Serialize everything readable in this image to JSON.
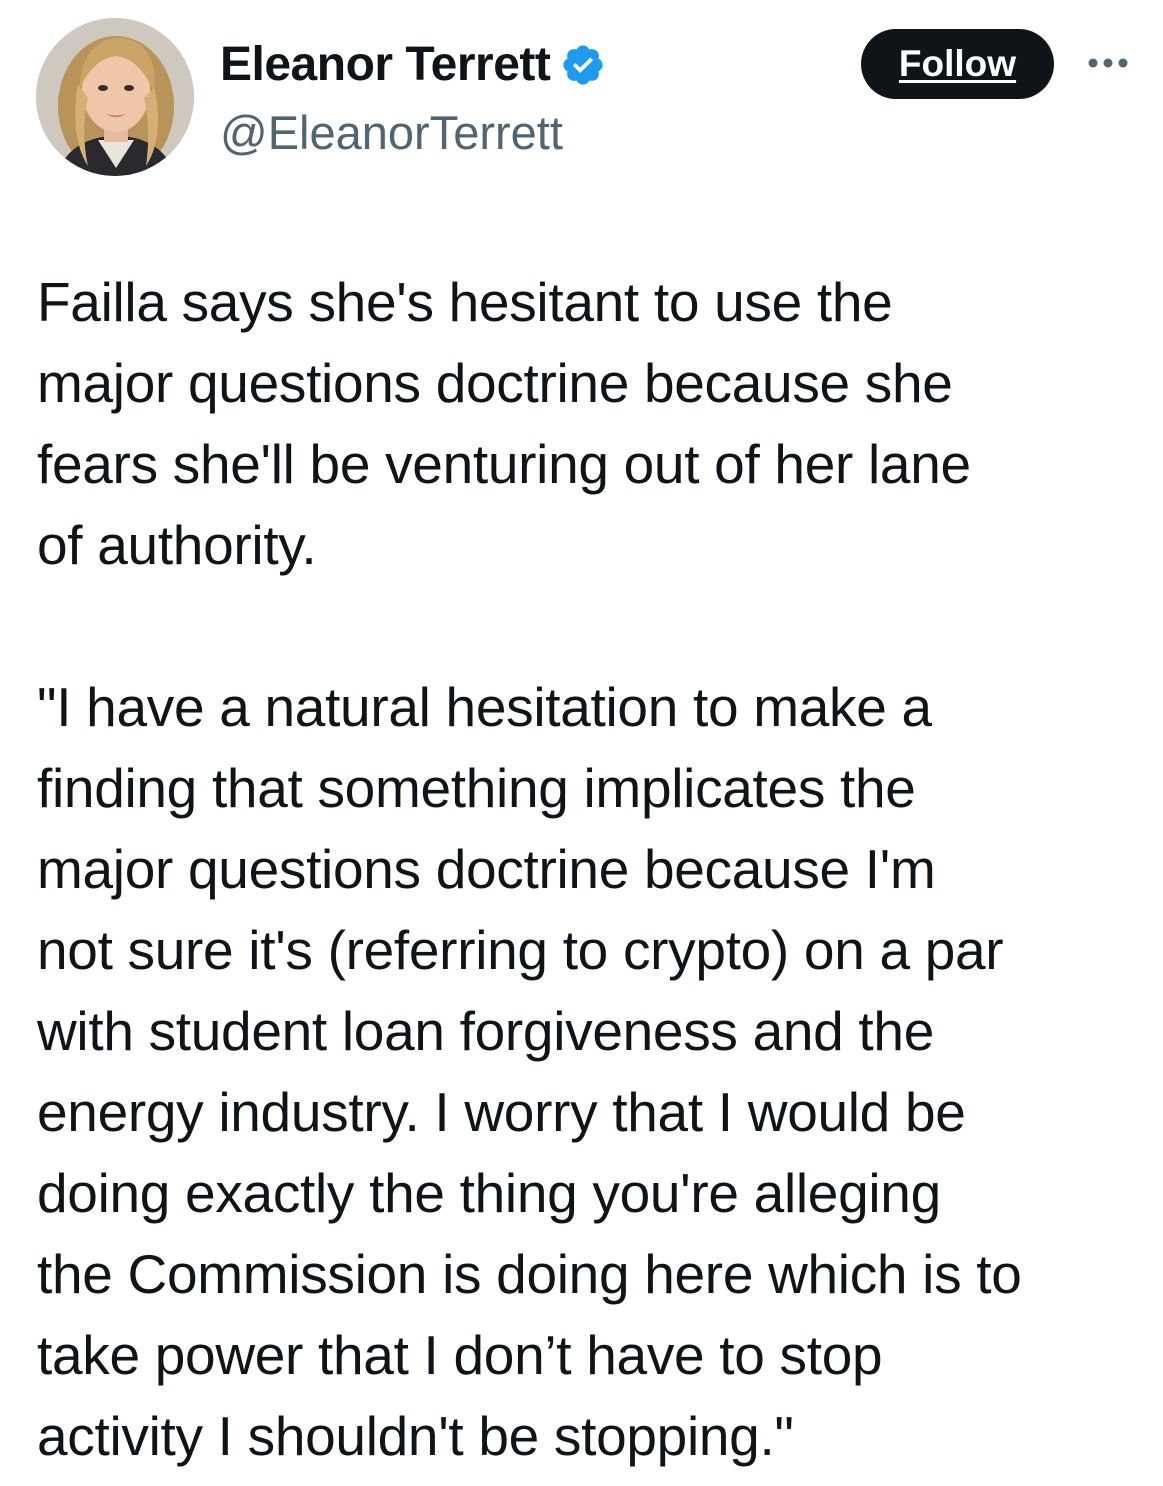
{
  "author": {
    "display_name": "Eleanor Terrett",
    "handle": "@EleanorTerrett",
    "verified": true,
    "verified_color": "#1d9bf0"
  },
  "actions": {
    "follow_label": "Follow",
    "more_icon": "more-horizontal-icon"
  },
  "tweet": {
    "paragraphs": [
      [
        "Failla says she's hesitant to use the",
        "major questions doctrine because she",
        "fears she'll be venturing out of her lane",
        "of authority."
      ],
      [
        "\"I have a natural hesitation to make a",
        "finding that something implicates the",
        "major questions doctrine because I'm",
        "not sure it's (referring to crypto) on a par",
        "with student loan forgiveness and the",
        "energy industry. I worry that I would be",
        "doing exactly the thing you're alleging",
        "the Commission is doing here which is to",
        "take power that I don’t have to stop",
        "activity I shouldn't be stopping.\""
      ]
    ]
  }
}
